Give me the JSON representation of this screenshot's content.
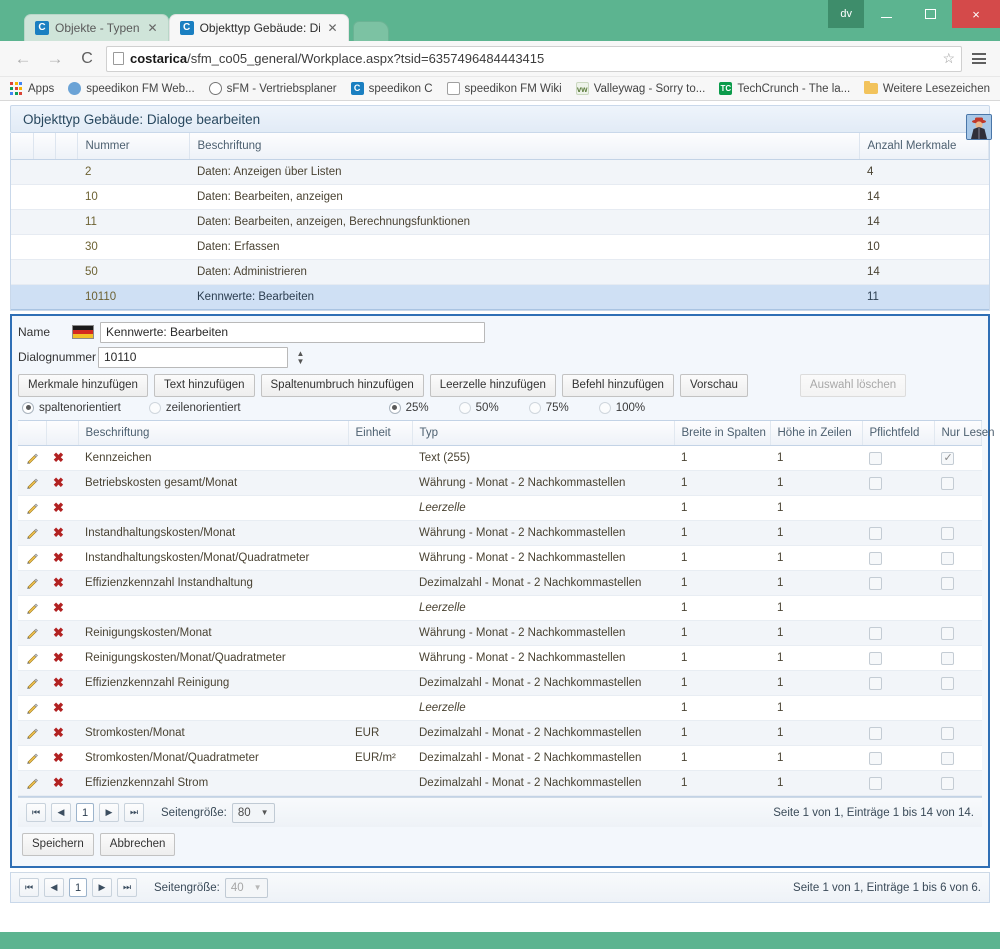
{
  "browser": {
    "user_chip": "dv",
    "tabs": [
      {
        "label": "Objekte - Typen",
        "favicon": "C",
        "active": false
      },
      {
        "label": "Objekttyp Gebäude: Dialo",
        "favicon": "C",
        "active": true
      }
    ],
    "window_controls": {
      "minimize": "minimize-icon",
      "maximize": "maximize-icon",
      "close": "×"
    },
    "nav": {
      "back": "←",
      "forward": "→",
      "reload": "C"
    },
    "url_host": "costarica",
    "url_path": "/sfm_co05_general/Workplace.aspx?tsid=6357496484443415",
    "bookmarks": [
      {
        "label": "Apps",
        "icon": "apps-grid-icon"
      },
      {
        "label": "speedikon FM Web...",
        "icon": "speedikon-icon"
      },
      {
        "label": "sFM - Vertriebsplaner",
        "icon": "clock-icon"
      },
      {
        "label": "speedikon C",
        "icon": "speedikon-c-icon"
      },
      {
        "label": "speedikon FM Wiki",
        "icon": "page-icon"
      },
      {
        "label": "Valleywag - Sorry to...",
        "icon": "vw-icon"
      },
      {
        "label": "TechCrunch - The la...",
        "icon": "tc-icon"
      }
    ],
    "bookmarks_right": {
      "label": "Weitere Lesezeichen",
      "icon": "folder-icon"
    }
  },
  "page": {
    "title": "Objekttyp Gebäude: Dialoge bearbeiten",
    "avatar": "user-avatar"
  },
  "top_grid": {
    "columns": [
      "",
      "",
      "",
      "Nummer",
      "Beschriftung",
      "Anzahl Merkmale"
    ],
    "rows": [
      {
        "nummer": "2",
        "beschriftung": "Daten: Anzeigen über Listen",
        "anzahl": "4",
        "selected": false
      },
      {
        "nummer": "10",
        "beschriftung": "Daten: Bearbeiten, anzeigen",
        "anzahl": "14",
        "selected": false
      },
      {
        "nummer": "11",
        "beschriftung": "Daten: Bearbeiten, anzeigen, Berechnungsfunktionen",
        "anzahl": "14",
        "selected": false
      },
      {
        "nummer": "30",
        "beschriftung": "Daten: Erfassen",
        "anzahl": "10",
        "selected": false
      },
      {
        "nummer": "50",
        "beschriftung": "Daten: Administrieren",
        "anzahl": "14",
        "selected": false
      },
      {
        "nummer": "10110",
        "beschriftung": "Kennwerte: Bearbeiten",
        "anzahl": "11",
        "selected": true
      }
    ]
  },
  "editor": {
    "name_label": "Name",
    "flag": "german-flag-icon",
    "name_value": "Kennwerte: Bearbeiten",
    "dialognummer_label": "Dialognummer",
    "dialognummer_value": "10110",
    "buttons": [
      {
        "label": "Merkmale hinzufügen",
        "disabled": false
      },
      {
        "label": "Text hinzufügen",
        "disabled": false
      },
      {
        "label": "Spaltenumbruch hinzufügen",
        "disabled": false
      },
      {
        "label": "Leerzelle hinzufügen",
        "disabled": false
      },
      {
        "label": "Befehl hinzufügen",
        "disabled": false
      },
      {
        "label": "Vorschau",
        "disabled": false
      }
    ],
    "delete_button": {
      "label": "Auswahl löschen",
      "disabled": true
    },
    "orientation": [
      {
        "label": "spaltenorientiert",
        "checked": true
      },
      {
        "label": "zeilenorientiert",
        "checked": false
      }
    ],
    "percent": [
      {
        "label": "25%",
        "checked": true
      },
      {
        "label": "50%",
        "checked": false
      },
      {
        "label": "75%",
        "checked": false
      },
      {
        "label": "100%",
        "checked": false
      }
    ]
  },
  "detail_grid": {
    "columns": [
      "",
      "",
      "Beschriftung",
      "Einheit",
      "Typ",
      "Breite in Spalten",
      "Höhe in Zeilen",
      "Pflichtfeld",
      "Nur Lesen"
    ],
    "rows": [
      {
        "beschriftung": "Kennzeichen",
        "einheit": "",
        "typ": "Text (255)",
        "typ_italic": false,
        "breite": "1",
        "hoehe": "1",
        "pflicht": false,
        "pflicht_shown": true,
        "nurlesen": true,
        "nurlesen_shown": true
      },
      {
        "beschriftung": "Betriebskosten gesamt/Monat",
        "einheit": "",
        "typ": "Währung - Monat - 2 Nachkommastellen",
        "typ_italic": false,
        "breite": "1",
        "hoehe": "1",
        "pflicht": false,
        "pflicht_shown": true,
        "nurlesen": false,
        "nurlesen_shown": true
      },
      {
        "beschriftung": "",
        "einheit": "",
        "typ": "Leerzelle",
        "typ_italic": true,
        "breite": "1",
        "hoehe": "1",
        "pflicht": false,
        "pflicht_shown": false,
        "nurlesen": false,
        "nurlesen_shown": false
      },
      {
        "beschriftung": "Instandhaltungskosten/Monat",
        "einheit": "",
        "typ": "Währung - Monat - 2 Nachkommastellen",
        "typ_italic": false,
        "breite": "1",
        "hoehe": "1",
        "pflicht": false,
        "pflicht_shown": true,
        "nurlesen": false,
        "nurlesen_shown": true
      },
      {
        "beschriftung": "Instandhaltungskosten/Monat/Quadratmeter",
        "einheit": "",
        "typ": "Währung - Monat - 2 Nachkommastellen",
        "typ_italic": false,
        "breite": "1",
        "hoehe": "1",
        "pflicht": false,
        "pflicht_shown": true,
        "nurlesen": false,
        "nurlesen_shown": true
      },
      {
        "beschriftung": "Effizienzkennzahl Instandhaltung",
        "einheit": "",
        "typ": "Dezimalzahl - Monat - 2 Nachkommastellen",
        "typ_italic": false,
        "breite": "1",
        "hoehe": "1",
        "pflicht": false,
        "pflicht_shown": true,
        "nurlesen": false,
        "nurlesen_shown": true
      },
      {
        "beschriftung": "",
        "einheit": "",
        "typ": "Leerzelle",
        "typ_italic": true,
        "breite": "1",
        "hoehe": "1",
        "pflicht": false,
        "pflicht_shown": false,
        "nurlesen": false,
        "nurlesen_shown": false
      },
      {
        "beschriftung": "Reinigungskosten/Monat",
        "einheit": "",
        "typ": "Währung - Monat - 2 Nachkommastellen",
        "typ_italic": false,
        "breite": "1",
        "hoehe": "1",
        "pflicht": false,
        "pflicht_shown": true,
        "nurlesen": false,
        "nurlesen_shown": true
      },
      {
        "beschriftung": "Reinigungskosten/Monat/Quadratmeter",
        "einheit": "",
        "typ": "Währung - Monat - 2 Nachkommastellen",
        "typ_italic": false,
        "breite": "1",
        "hoehe": "1",
        "pflicht": false,
        "pflicht_shown": true,
        "nurlesen": false,
        "nurlesen_shown": true
      },
      {
        "beschriftung": "Effizienzkennzahl Reinigung",
        "einheit": "",
        "typ": "Dezimalzahl - Monat - 2 Nachkommastellen",
        "typ_italic": false,
        "breite": "1",
        "hoehe": "1",
        "pflicht": false,
        "pflicht_shown": true,
        "nurlesen": false,
        "nurlesen_shown": true
      },
      {
        "beschriftung": "",
        "einheit": "",
        "typ": "Leerzelle",
        "typ_italic": true,
        "breite": "1",
        "hoehe": "1",
        "pflicht": false,
        "pflicht_shown": false,
        "nurlesen": false,
        "nurlesen_shown": false
      },
      {
        "beschriftung": "Stromkosten/Monat",
        "einheit": "EUR",
        "typ": "Dezimalzahl - Monat - 2 Nachkommastellen",
        "typ_italic": false,
        "breite": "1",
        "hoehe": "1",
        "pflicht": false,
        "pflicht_shown": true,
        "nurlesen": false,
        "nurlesen_shown": true
      },
      {
        "beschriftung": "Stromkosten/Monat/Quadratmeter",
        "einheit": "EUR/m²",
        "typ": "Dezimalzahl - Monat - 2 Nachkommastellen",
        "typ_italic": false,
        "breite": "1",
        "hoehe": "1",
        "pflicht": false,
        "pflicht_shown": true,
        "nurlesen": false,
        "nurlesen_shown": true
      },
      {
        "beschriftung": "Effizienzkennzahl Strom",
        "einheit": "",
        "typ": "Dezimalzahl - Monat - 2 Nachkommastellen",
        "typ_italic": false,
        "breite": "1",
        "hoehe": "1",
        "pflicht": false,
        "pflicht_shown": true,
        "nurlesen": false,
        "nurlesen_shown": true
      }
    ]
  },
  "inner_pager": {
    "first": "first-page-icon",
    "prev": "prev-page-icon",
    "page": "1",
    "next": "next-page-icon",
    "last": "last-page-icon",
    "page_size_label": "Seitengröße:",
    "page_size_value": "80",
    "status": "Seite 1 von 1, Einträge 1 bis 14 von 14."
  },
  "editor_actions": {
    "save": "Speichern",
    "cancel": "Abbrechen"
  },
  "outer_pager": {
    "first": "first-page-icon",
    "prev": "prev-page-icon",
    "page": "1",
    "next": "next-page-icon",
    "last": "last-page-icon",
    "page_size_label": "Seitengröße:",
    "page_size_value": "40",
    "status": "Seite 1 von 1, Einträge 1 bis 6 von 6."
  },
  "colors": {
    "chrome_green": "#5cb490",
    "editor_border": "#2f6fb5",
    "selection_blue": "#cfe0f4",
    "close_red": "#d44a4a"
  }
}
